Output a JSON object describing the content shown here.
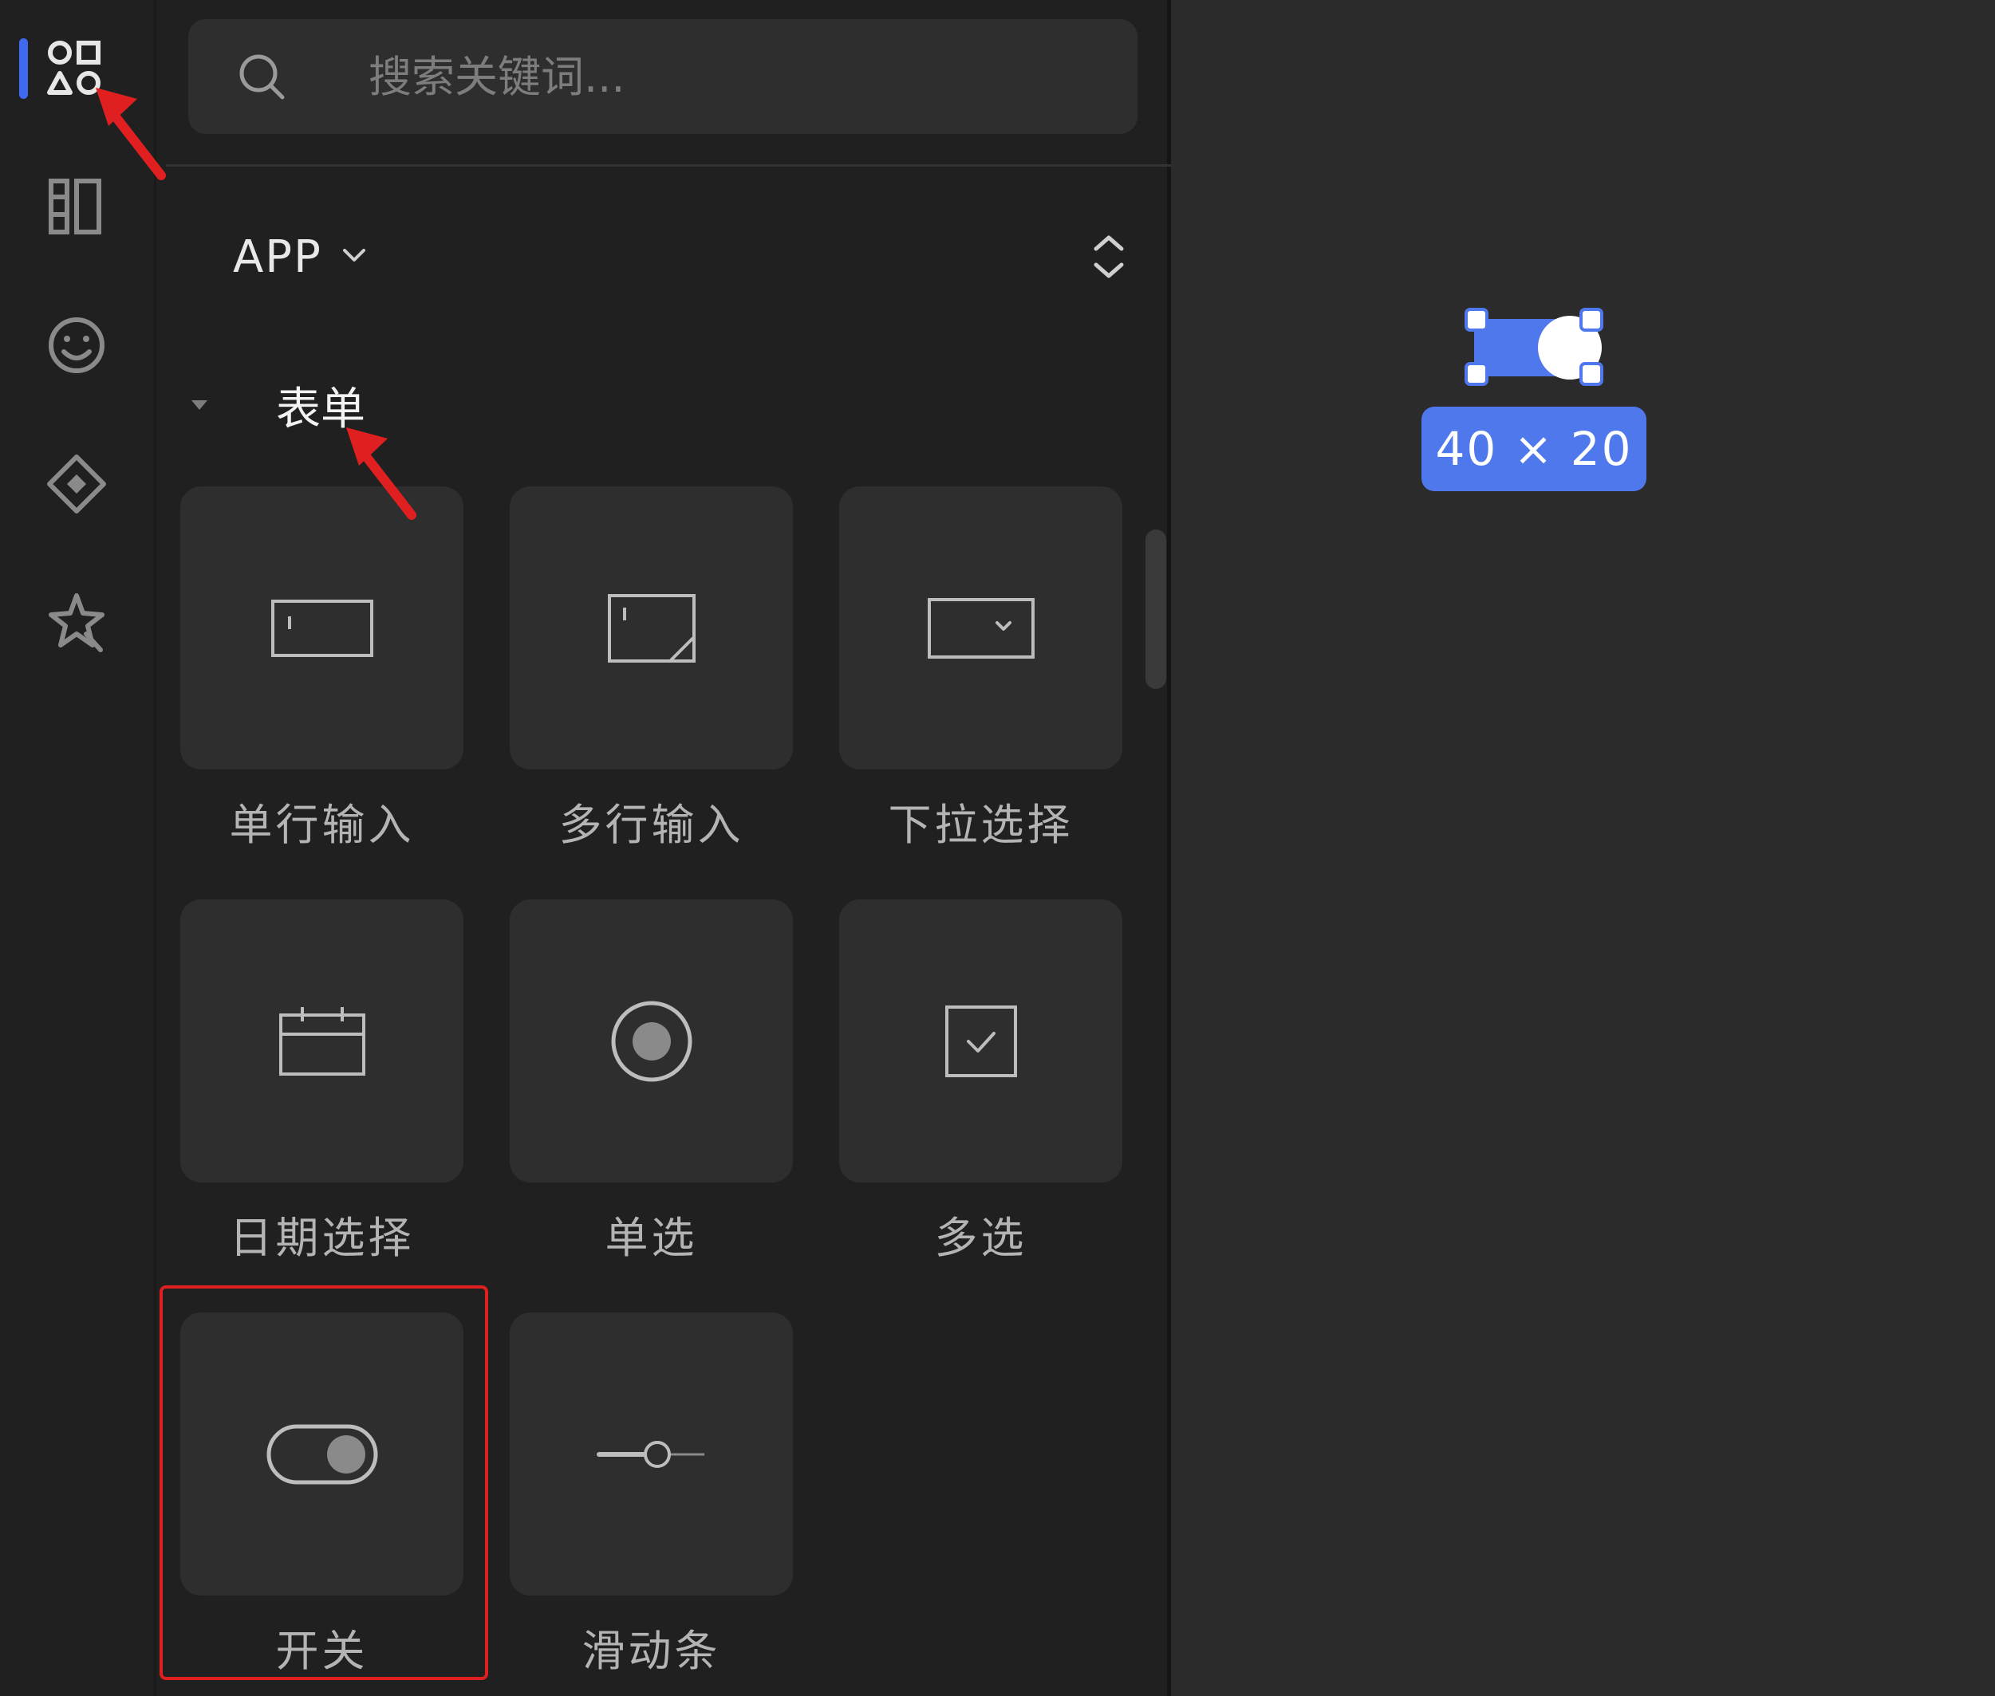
{
  "search": {
    "placeholder": "搜索关键词..."
  },
  "scope": {
    "label": "APP"
  },
  "section": {
    "title": "表单"
  },
  "components": [
    {
      "label": "单行输入",
      "icon": "single-line-input-icon"
    },
    {
      "label": "多行输入",
      "icon": "multi-line-input-icon"
    },
    {
      "label": "下拉选择",
      "icon": "dropdown-select-icon"
    },
    {
      "label": "日期选择",
      "icon": "date-picker-icon"
    },
    {
      "label": "单选",
      "icon": "radio-icon"
    },
    {
      "label": "多选",
      "icon": "checkbox-icon"
    },
    {
      "label": "开关",
      "icon": "switch-icon"
    },
    {
      "label": "滑动条",
      "icon": "slider-icon"
    }
  ],
  "canvas": {
    "selection_size": "40 × 20"
  },
  "colors": {
    "accent": "#3f6af0",
    "selection": "#4f78ec",
    "annotation": "#e02020",
    "panel_bg": "#202020",
    "canvas_bg": "#2b2b2b",
    "tile_bg": "#2e2e2e"
  }
}
